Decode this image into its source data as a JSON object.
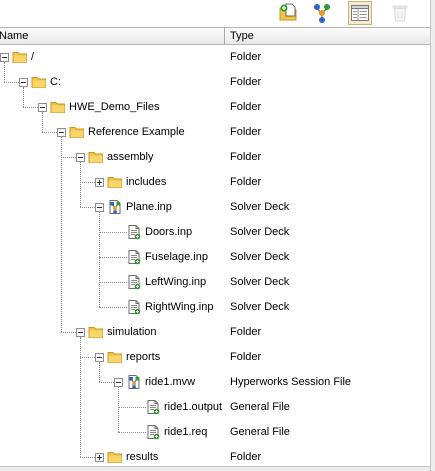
{
  "toolbar": {
    "buttons": [
      {
        "name": "add-file-button",
        "icon": "add-file-icon",
        "pressed": false,
        "disabled": false
      },
      {
        "name": "hierarchy-view-button",
        "icon": "hierarchy-icon",
        "pressed": false,
        "disabled": false
      },
      {
        "name": "list-view-button",
        "icon": "list-view-icon",
        "pressed": true,
        "disabled": false
      },
      {
        "name": "delete-button",
        "icon": "trash-icon",
        "pressed": false,
        "disabled": true
      }
    ]
  },
  "columns": {
    "name": "Name",
    "type": "Type"
  },
  "colors": {
    "folder": "#f2c443",
    "folder_dark": "#c9962a",
    "file_green": "#2f9b2f",
    "deck_blue": "#2b63c6"
  },
  "tree": [
    {
      "label": "/",
      "type": "Folder",
      "depth": 0,
      "icon": "folder-icon",
      "toggle": "minus"
    },
    {
      "label": "C:",
      "type": "Folder",
      "depth": 1,
      "icon": "folder-icon",
      "toggle": "minus"
    },
    {
      "label": "HWE_Demo_Files",
      "type": "Folder",
      "depth": 2,
      "icon": "folder-icon",
      "toggle": "minus"
    },
    {
      "label": "Reference Example",
      "type": "Folder",
      "depth": 3,
      "icon": "folder-icon",
      "toggle": "minus"
    },
    {
      "label": "assembly",
      "type": "Folder",
      "depth": 4,
      "icon": "folder-icon",
      "toggle": "minus"
    },
    {
      "label": "includes",
      "type": "Folder",
      "depth": 5,
      "icon": "folder-icon",
      "toggle": "plus"
    },
    {
      "label": "Plane.inp",
      "type": "Solver Deck",
      "depth": 5,
      "icon": "solver-deck-icon",
      "toggle": "minus"
    },
    {
      "label": "Doors.inp",
      "type": "Solver Deck",
      "depth": 6,
      "icon": "file-icon",
      "toggle": "none"
    },
    {
      "label": "Fuselage.inp",
      "type": "Solver Deck",
      "depth": 6,
      "icon": "file-icon",
      "toggle": "none"
    },
    {
      "label": "LeftWing.inp",
      "type": "Solver Deck",
      "depth": 6,
      "icon": "file-icon",
      "toggle": "none"
    },
    {
      "label": "RightWing.inp",
      "type": "Solver Deck",
      "depth": 6,
      "icon": "file-icon",
      "toggle": "none"
    },
    {
      "label": "simulation",
      "type": "Folder",
      "depth": 4,
      "icon": "folder-icon",
      "toggle": "minus"
    },
    {
      "label": "reports",
      "type": "Folder",
      "depth": 5,
      "icon": "folder-icon",
      "toggle": "minus"
    },
    {
      "label": "ride1.mvw",
      "type": "Hyperworks Session File",
      "depth": 6,
      "icon": "session-file-icon",
      "toggle": "minus"
    },
    {
      "label": "ride1.output",
      "type": "General File",
      "depth": 7,
      "icon": "file-icon",
      "toggle": "none"
    },
    {
      "label": "ride1.req",
      "type": "General File",
      "depth": 7,
      "icon": "file-icon",
      "toggle": "none"
    },
    {
      "label": "results",
      "type": "Folder",
      "depth": 5,
      "icon": "folder-icon",
      "toggle": "plus"
    }
  ]
}
